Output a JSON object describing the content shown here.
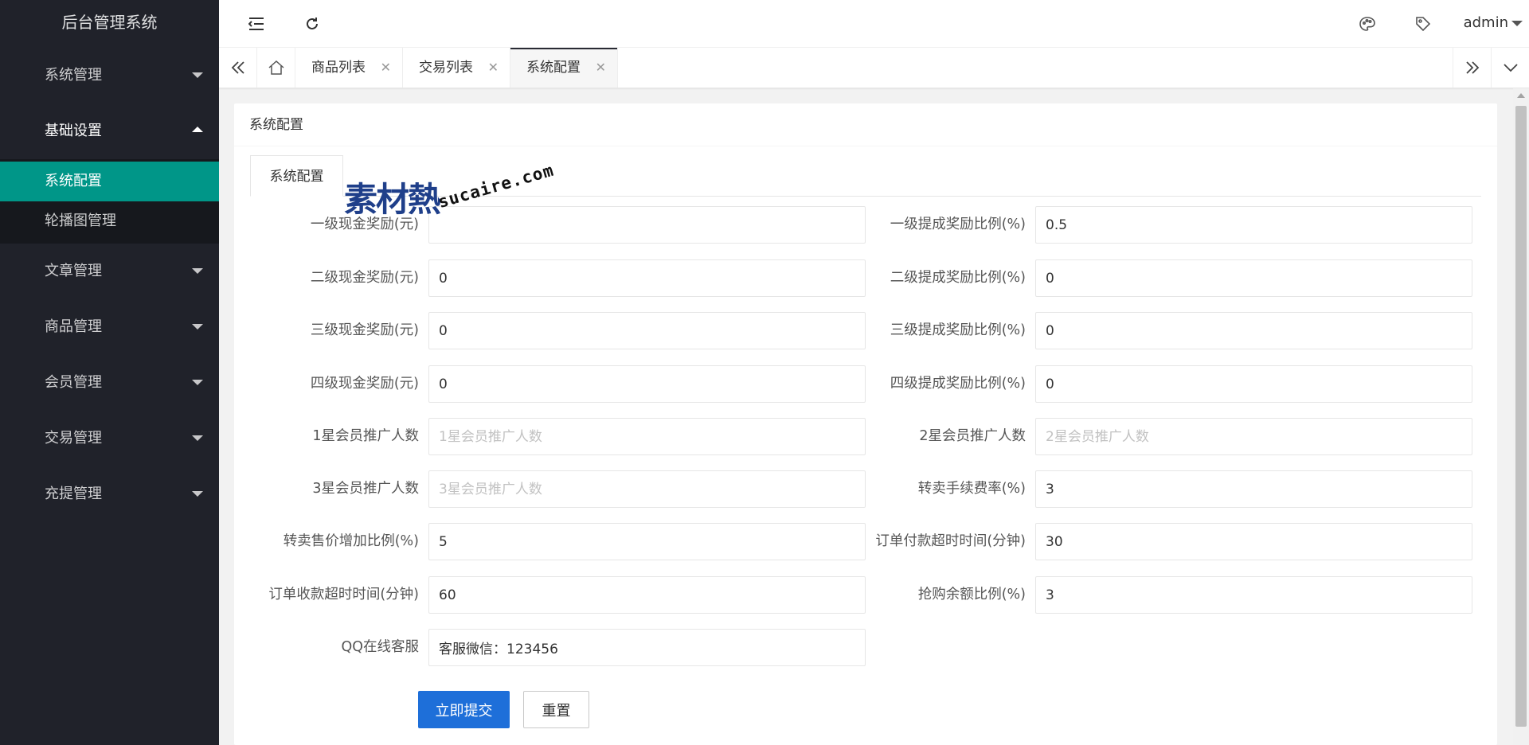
{
  "app": {
    "title": "后台管理系统"
  },
  "sidebar": {
    "groups": [
      {
        "label": "系统管理",
        "expanded": false
      },
      {
        "label": "基础设置",
        "expanded": true,
        "items": [
          {
            "label": "系统配置",
            "active": true
          },
          {
            "label": "轮播图管理",
            "active": false
          }
        ]
      },
      {
        "label": "文章管理",
        "expanded": false
      },
      {
        "label": "商品管理",
        "expanded": false
      },
      {
        "label": "会员管理",
        "expanded": false
      },
      {
        "label": "交易管理",
        "expanded": false
      },
      {
        "label": "充提管理",
        "expanded": false
      }
    ]
  },
  "header": {
    "icons": [
      "menu-fold-icon",
      "refresh-icon",
      "theme-palette-icon",
      "tag-icon"
    ],
    "user": "admin"
  },
  "tabs": {
    "items": [
      {
        "label": "商品列表",
        "active": false
      },
      {
        "label": "交易列表",
        "active": false
      },
      {
        "label": "系统配置",
        "active": true
      }
    ]
  },
  "card": {
    "title": "系统配置",
    "tab": "系统配置"
  },
  "form": {
    "left": [
      {
        "label": "一级现金奖励(元)",
        "value": "",
        "placeholder": ""
      },
      {
        "label": "二级现金奖励(元)",
        "value": "0",
        "placeholder": ""
      },
      {
        "label": "三级现金奖励(元)",
        "value": "0",
        "placeholder": ""
      },
      {
        "label": "四级现金奖励(元)",
        "value": "0",
        "placeholder": ""
      },
      {
        "label": "1星会员推广人数",
        "value": "",
        "placeholder": "1星会员推广人数"
      },
      {
        "label": "3星会员推广人数",
        "value": "",
        "placeholder": "3星会员推广人数"
      },
      {
        "label": "转卖售价增加比例(%)",
        "value": "5",
        "placeholder": ""
      },
      {
        "label": "订单收款超时时间(分钟)",
        "value": "60",
        "placeholder": ""
      },
      {
        "label": "QQ在线客服",
        "value": "客服微信：123456",
        "placeholder": ""
      }
    ],
    "right": [
      {
        "label": "一级提成奖励比例(%)",
        "value": "0.5",
        "placeholder": ""
      },
      {
        "label": "二级提成奖励比例(%)",
        "value": "0",
        "placeholder": ""
      },
      {
        "label": "三级提成奖励比例(%)",
        "value": "0",
        "placeholder": ""
      },
      {
        "label": "四级提成奖励比例(%)",
        "value": "0",
        "placeholder": ""
      },
      {
        "label": "2星会员推广人数",
        "value": "",
        "placeholder": "2星会员推广人数"
      },
      {
        "label": "转卖手续费率(%)",
        "value": "3",
        "placeholder": ""
      },
      {
        "label": "订单付款超时时间(分钟)",
        "value": "30",
        "placeholder": ""
      },
      {
        "label": "抢购余额比例(%)",
        "value": "3",
        "placeholder": ""
      }
    ],
    "submit_label": "立即提交",
    "reset_label": "重置"
  },
  "watermark": {
    "cn": "素材熱",
    "en": "sucaire.com"
  },
  "colors": {
    "sidebar_bg": "#20222a",
    "active_green": "#009688",
    "primary_blue": "#1e6fd9"
  }
}
